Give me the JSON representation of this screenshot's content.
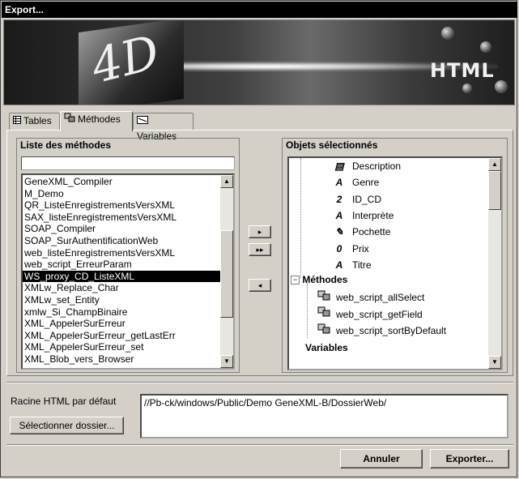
{
  "window": {
    "title": "Export..."
  },
  "banner": {
    "logo_text": "4D",
    "product_label": "HTML"
  },
  "tabs": [
    {
      "label": "Tables",
      "icon": "table-icon"
    },
    {
      "label": "Méthodes",
      "icon": "methods-icon"
    },
    {
      "label": "Variables",
      "icon": "variables-icon"
    }
  ],
  "methods_list": {
    "title": "Liste des méthodes",
    "filter_value": "",
    "items": [
      "GeneXML_Compiler",
      "M_Demo",
      "QR_ListeEnregistrementsVersXML",
      "SAX_listeEnregistrementsVersXML",
      "SOAP_Compiler",
      "SOAP_SurAuthentificationWeb",
      "web_listeEnregistrementsVersXML",
      "web_script_ErreurParam",
      "WS_proxy_CD_ListeXML",
      "XMLw_Replace_Char",
      "XMLw_set_Entity",
      "xmlw_Si_ChampBinaire",
      "XML_AppelerSurErreur",
      "XML_AppelerSurErreur_getLastErr",
      "XML_AppelerSurErreur_set",
      "XML_Blob_vers_Browser"
    ],
    "selected_index": 8
  },
  "transfer_buttons": {
    "add": "▸",
    "add_all": "▸▸",
    "remove": "◂"
  },
  "selected_objects": {
    "title": "Objets sélectionnés",
    "fields": [
      {
        "label": "Description",
        "icon": "text-field-icon",
        "glyph": "▤"
      },
      {
        "label": "Genre",
        "icon": "alpha-field-icon",
        "glyph": "A"
      },
      {
        "label": "ID_CD",
        "icon": "integer-field-icon",
        "glyph": "2"
      },
      {
        "label": "Interprète",
        "icon": "alpha-field-icon",
        "glyph": "A"
      },
      {
        "label": "Pochette",
        "icon": "picture-field-icon",
        "glyph": "✎"
      },
      {
        "label": "Prix",
        "icon": "real-field-icon",
        "glyph": "0"
      },
      {
        "label": "Titre",
        "icon": "alpha-field-icon",
        "glyph": "A"
      }
    ],
    "methods_node": {
      "label": "Méthodes",
      "toggle": "−"
    },
    "methods": [
      {
        "label": "web_script_allSelect"
      },
      {
        "label": "web_script_getField"
      },
      {
        "label": "web_script_sortByDefault"
      }
    ],
    "variables_node": {
      "label": "Variables"
    }
  },
  "html_root": {
    "label": "Racine HTML par défaut",
    "path": "//Pb-ck/windows/Public/Demo GeneXML-B/DossierWeb/",
    "select_button": "Sélectionner dossier..."
  },
  "footer": {
    "cancel": "Annuler",
    "export": "Exporter..."
  }
}
